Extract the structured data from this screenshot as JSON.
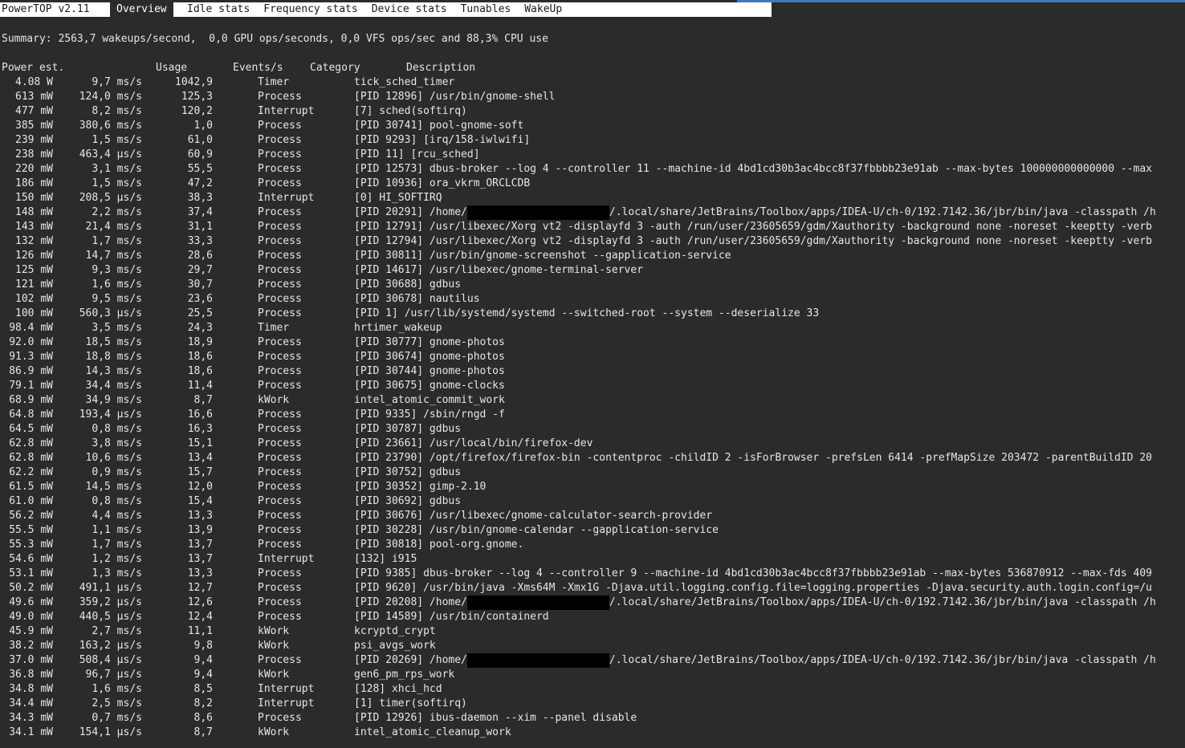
{
  "menubar": {
    "app_title": "PowerTOP v2.11",
    "tabs": [
      {
        "label": "Overview",
        "active": true
      },
      {
        "label": "Idle stats",
        "active": false
      },
      {
        "label": "Frequency stats",
        "active": false
      },
      {
        "label": "Device stats",
        "active": false
      },
      {
        "label": "Tunables",
        "active": false
      },
      {
        "label": "WakeUp",
        "active": false
      }
    ]
  },
  "summary": "Summary: 2563,7 wakeups/second,  0,0 GPU ops/seconds, 0,0 VFS ops/sec and 88,3% CPU use",
  "columns": {
    "power": "Power est.",
    "usage": "Usage",
    "events": "Events/s",
    "category": "Category",
    "description": "Description"
  },
  "rows": [
    {
      "power": "4.08 W",
      "usage": "9,7 ms/s",
      "events": "1042,9",
      "category": "Timer",
      "desc": "tick_sched_timer"
    },
    {
      "power": "613 mW",
      "usage": "124,0 ms/s",
      "events": "125,3",
      "category": "Process",
      "desc": "[PID 12896] /usr/bin/gnome-shell"
    },
    {
      "power": "477 mW",
      "usage": "8,2 ms/s",
      "events": "120,2",
      "category": "Interrupt",
      "desc": "[7] sched(softirq)"
    },
    {
      "power": "385 mW",
      "usage": "380,6 ms/s",
      "events": "1,0",
      "category": "Process",
      "desc": "[PID 30741] pool-gnome-soft"
    },
    {
      "power": "239 mW",
      "usage": "1,5 ms/s",
      "events": "61,0",
      "category": "Process",
      "desc": "[PID 9293] [irq/158-iwlwifi]"
    },
    {
      "power": "238 mW",
      "usage": "463,4 µs/s",
      "events": "60,9",
      "category": "Process",
      "desc": "[PID 11] [rcu_sched]"
    },
    {
      "power": "220 mW",
      "usage": "3,1 ms/s",
      "events": "55,5",
      "category": "Process",
      "desc": "[PID 12573] dbus-broker --log 4 --controller 11 --machine-id 4bd1cd30b3ac4bcc8f37fbbbb23e91ab --max-bytes 100000000000000 --max"
    },
    {
      "power": "186 mW",
      "usage": "1,5 ms/s",
      "events": "47,2",
      "category": "Process",
      "desc": "[PID 10936] ora_vkrm_ORCLCDB"
    },
    {
      "power": "150 mW",
      "usage": "208,5 µs/s",
      "events": "38,3",
      "category": "Interrupt",
      "desc": "[0] HI_SOFTIRQ"
    },
    {
      "power": "148 mW",
      "usage": "2,2 ms/s",
      "events": "37,4",
      "category": "Process",
      "desc": "[PID 20291] /home/",
      "redacted": true,
      "desc_after": "/.local/share/JetBrains/Toolbox/apps/IDEA-U/ch-0/192.7142.36/jbr/bin/java -classpath /h"
    },
    {
      "power": "143 mW",
      "usage": "21,4 ms/s",
      "events": "31,1",
      "category": "Process",
      "desc": "[PID 12791] /usr/libexec/Xorg vt2 -displayfd 3 -auth /run/user/23605659/gdm/Xauthority -background none -noreset -keeptty -verb"
    },
    {
      "power": "132 mW",
      "usage": "1,7 ms/s",
      "events": "33,3",
      "category": "Process",
      "desc": "[PID 12794] /usr/libexec/Xorg vt2 -displayfd 3 -auth /run/user/23605659/gdm/Xauthority -background none -noreset -keeptty -verb"
    },
    {
      "power": "126 mW",
      "usage": "14,7 ms/s",
      "events": "28,6",
      "category": "Process",
      "desc": "[PID 30811] /usr/bin/gnome-screenshot --gapplication-service"
    },
    {
      "power": "125 mW",
      "usage": "9,3 ms/s",
      "events": "29,7",
      "category": "Process",
      "desc": "[PID 14617] /usr/libexec/gnome-terminal-server"
    },
    {
      "power": "121 mW",
      "usage": "1,6 ms/s",
      "events": "30,7",
      "category": "Process",
      "desc": "[PID 30688] gdbus"
    },
    {
      "power": "102 mW",
      "usage": "9,5 ms/s",
      "events": "23,6",
      "category": "Process",
      "desc": "[PID 30678] nautilus"
    },
    {
      "power": "100 mW",
      "usage": "560,3 µs/s",
      "events": "25,5",
      "category": "Process",
      "desc": "[PID 1] /usr/lib/systemd/systemd --switched-root --system --deserialize 33"
    },
    {
      "power": "98.4 mW",
      "usage": "3,5 ms/s",
      "events": "24,3",
      "category": "Timer",
      "desc": "hrtimer_wakeup"
    },
    {
      "power": "92.0 mW",
      "usage": "18,5 ms/s",
      "events": "18,9",
      "category": "Process",
      "desc": "[PID 30777] gnome-photos"
    },
    {
      "power": "91.3 mW",
      "usage": "18,8 ms/s",
      "events": "18,6",
      "category": "Process",
      "desc": "[PID 30674] gnome-photos"
    },
    {
      "power": "86.9 mW",
      "usage": "14,3 ms/s",
      "events": "18,6",
      "category": "Process",
      "desc": "[PID 30744] gnome-photos"
    },
    {
      "power": "79.1 mW",
      "usage": "34,4 ms/s",
      "events": "11,4",
      "category": "Process",
      "desc": "[PID 30675] gnome-clocks"
    },
    {
      "power": "68.9 mW",
      "usage": "34,9 ms/s",
      "events": "8,7",
      "category": "kWork",
      "desc": "intel_atomic_commit_work"
    },
    {
      "power": "64.8 mW",
      "usage": "193,4 µs/s",
      "events": "16,6",
      "category": "Process",
      "desc": "[PID 9335] /sbin/rngd -f"
    },
    {
      "power": "64.5 mW",
      "usage": "0,8 ms/s",
      "events": "16,3",
      "category": "Process",
      "desc": "[PID 30787] gdbus"
    },
    {
      "power": "62.8 mW",
      "usage": "3,8 ms/s",
      "events": "15,1",
      "category": "Process",
      "desc": "[PID 23661] /usr/local/bin/firefox-dev"
    },
    {
      "power": "62.8 mW",
      "usage": "10,6 ms/s",
      "events": "13,4",
      "category": "Process",
      "desc": "[PID 23790] /opt/firefox/firefox-bin -contentproc -childID 2 -isForBrowser -prefsLen 6414 -prefMapSize 203472 -parentBuildID 20"
    },
    {
      "power": "62.2 mW",
      "usage": "0,9 ms/s",
      "events": "15,7",
      "category": "Process",
      "desc": "[PID 30752] gdbus"
    },
    {
      "power": "61.5 mW",
      "usage": "14,5 ms/s",
      "events": "12,0",
      "category": "Process",
      "desc": "[PID 30352] gimp-2.10"
    },
    {
      "power": "61.0 mW",
      "usage": "0,8 ms/s",
      "events": "15,4",
      "category": "Process",
      "desc": "[PID 30692] gdbus"
    },
    {
      "power": "56.2 mW",
      "usage": "4,4 ms/s",
      "events": "13,3",
      "category": "Process",
      "desc": "[PID 30676] /usr/libexec/gnome-calculator-search-provider"
    },
    {
      "power": "55.5 mW",
      "usage": "1,1 ms/s",
      "events": "13,9",
      "category": "Process",
      "desc": "[PID 30228] /usr/bin/gnome-calendar --gapplication-service"
    },
    {
      "power": "55.3 mW",
      "usage": "1,7 ms/s",
      "events": "13,7",
      "category": "Process",
      "desc": "[PID 30818] pool-org.gnome."
    },
    {
      "power": "54.6 mW",
      "usage": "1,2 ms/s",
      "events": "13,7",
      "category": "Interrupt",
      "desc": "[132] i915"
    },
    {
      "power": "53.1 mW",
      "usage": "1,3 ms/s",
      "events": "13,3",
      "category": "Process",
      "desc": "[PID 9385] dbus-broker --log 4 --controller 9 --machine-id 4bd1cd30b3ac4bcc8f37fbbbb23e91ab --max-bytes 536870912 --max-fds 409"
    },
    {
      "power": "50.2 mW",
      "usage": "491,1 µs/s",
      "events": "12,7",
      "category": "Process",
      "desc": "[PID 9620] /usr/bin/java -Xms64M -Xmx1G -Djava.util.logging.config.file=logging.properties -Djava.security.auth.login.config=/u"
    },
    {
      "power": "49.6 mW",
      "usage": "359,2 µs/s",
      "events": "12,6",
      "category": "Process",
      "desc": "[PID 20208] /home/",
      "redacted": true,
      "desc_after": "/.local/share/JetBrains/Toolbox/apps/IDEA-U/ch-0/192.7142.36/jbr/bin/java -classpath /h"
    },
    {
      "power": "49.0 mW",
      "usage": "440,5 µs/s",
      "events": "12,4",
      "category": "Process",
      "desc": "[PID 14589] /usr/bin/containerd"
    },
    {
      "power": "45.9 mW",
      "usage": "2,7 ms/s",
      "events": "11,1",
      "category": "kWork",
      "desc": "kcryptd_crypt"
    },
    {
      "power": "38.2 mW",
      "usage": "163,2 µs/s",
      "events": "9,8",
      "category": "kWork",
      "desc": "psi_avgs_work"
    },
    {
      "power": "37.0 mW",
      "usage": "508,4 µs/s",
      "events": "9,4",
      "category": "Process",
      "desc": "[PID 20269] /home/",
      "redacted": true,
      "desc_after": "/.local/share/JetBrains/Toolbox/apps/IDEA-U/ch-0/192.7142.36/jbr/bin/java -classpath /h"
    },
    {
      "power": "36.8 mW",
      "usage": "96,7 µs/s",
      "events": "9,4",
      "category": "kWork",
      "desc": "gen6_pm_rps_work"
    },
    {
      "power": "34.8 mW",
      "usage": "1,6 ms/s",
      "events": "8,5",
      "category": "Interrupt",
      "desc": "[128] xhci_hcd"
    },
    {
      "power": "34.4 mW",
      "usage": "2,5 ms/s",
      "events": "8,2",
      "category": "Interrupt",
      "desc": "[1] timer(softirq)"
    },
    {
      "power": "34.3 mW",
      "usage": "0,7 ms/s",
      "events": "8,6",
      "category": "Process",
      "desc": "[PID 12926] ibus-daemon --xim --panel disable"
    },
    {
      "power": "34.1 mW",
      "usage": "154,1 µs/s",
      "events": "8,7",
      "category": "kWork",
      "desc": "intel_atomic_cleanup_work"
    }
  ]
}
